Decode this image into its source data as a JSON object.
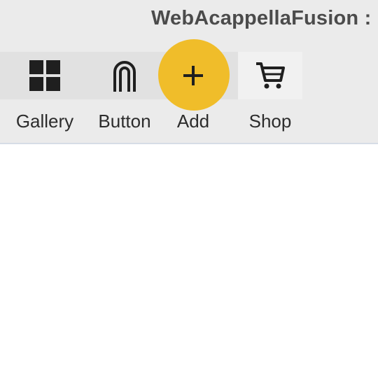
{
  "window": {
    "title": "WebAcappellaFusion :"
  },
  "toolbar": {
    "items": [
      {
        "label": "Gallery",
        "icon": "gallery-grid-icon"
      },
      {
        "label": "Button",
        "icon": "touch-button-icon"
      },
      {
        "label": "Add",
        "icon": "plus-icon",
        "highlighted": true
      },
      {
        "label": "Shop",
        "icon": "shopping-cart-icon"
      }
    ]
  },
  "colors": {
    "toolbar_bg": "#ebebeb",
    "highlight": "#f0bd2a",
    "icon": "#1f1f1f",
    "title_text": "#4b4b4b"
  }
}
